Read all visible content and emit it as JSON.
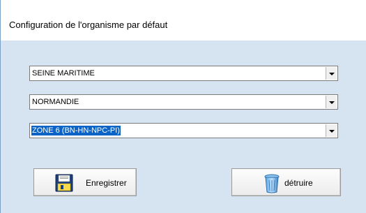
{
  "window": {
    "title": "Configuration de l'organisme par défaut"
  },
  "form": {
    "department": {
      "value": "SEINE MARITIME"
    },
    "region": {
      "value": "NORMANDIE"
    },
    "zone": {
      "value": "ZONE 6 (BN-HN-NPC-PI)"
    }
  },
  "buttons": {
    "save_label": "Enregistrer",
    "delete_label": "détruire",
    "save_icon": "floppy-disk-icon",
    "delete_icon": "trash-can-icon"
  },
  "colors": {
    "client_background": "#d6e4f2",
    "selection": "#0a64c8"
  }
}
